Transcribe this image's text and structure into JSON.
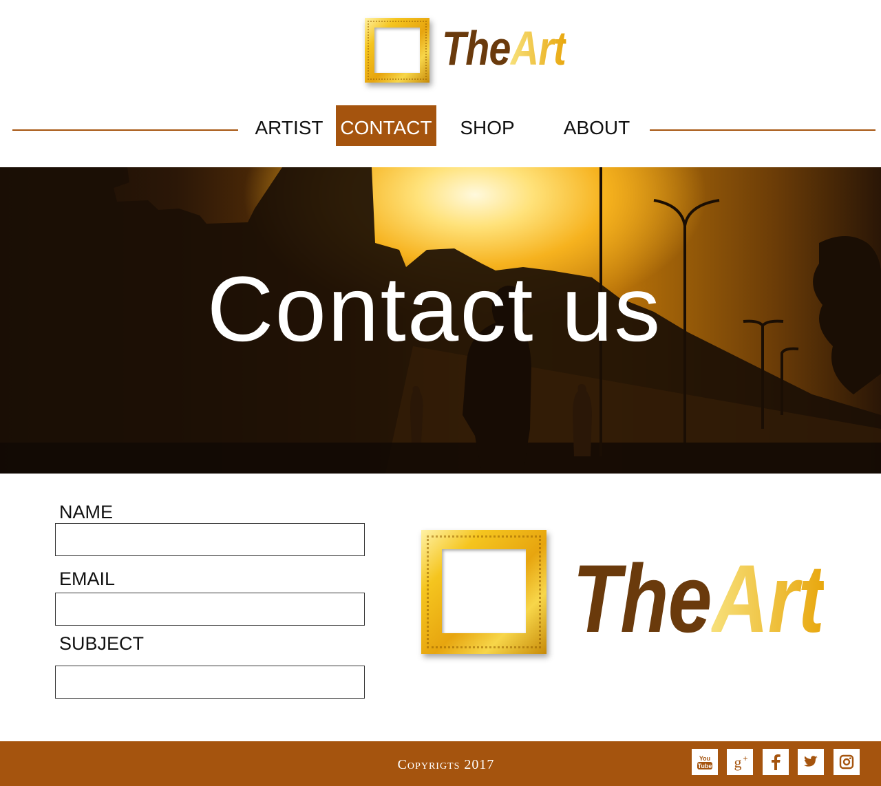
{
  "brand": {
    "name_part1": "The",
    "name_part2": "Art"
  },
  "nav": {
    "items": [
      {
        "label": "ARTIST",
        "active": false
      },
      {
        "label": "CONTACT",
        "active": true
      },
      {
        "label": "SHOP",
        "active": false
      },
      {
        "label": "ABOUT",
        "active": false
      }
    ]
  },
  "hero": {
    "title": "Contact us"
  },
  "form": {
    "name_label": "NAME",
    "name_value": "",
    "email_label": "EMAIL",
    "email_value": "",
    "subject_label": "SUBJECT",
    "subject_value": ""
  },
  "footer": {
    "copyright": "Copyrigts 2017",
    "social": [
      {
        "icon": "youtube-icon",
        "glyph": "You\nTube"
      },
      {
        "icon": "google-plus-icon",
        "glyph": "g+"
      },
      {
        "icon": "facebook-icon",
        "glyph": "f"
      },
      {
        "icon": "twitter-icon",
        "glyph": "t"
      },
      {
        "icon": "instagram-icon",
        "glyph": "ig"
      }
    ]
  },
  "colors": {
    "accent": "#a5540e",
    "brand_dark": "#6a3a0c",
    "brand_gold": "#f0b21a"
  }
}
